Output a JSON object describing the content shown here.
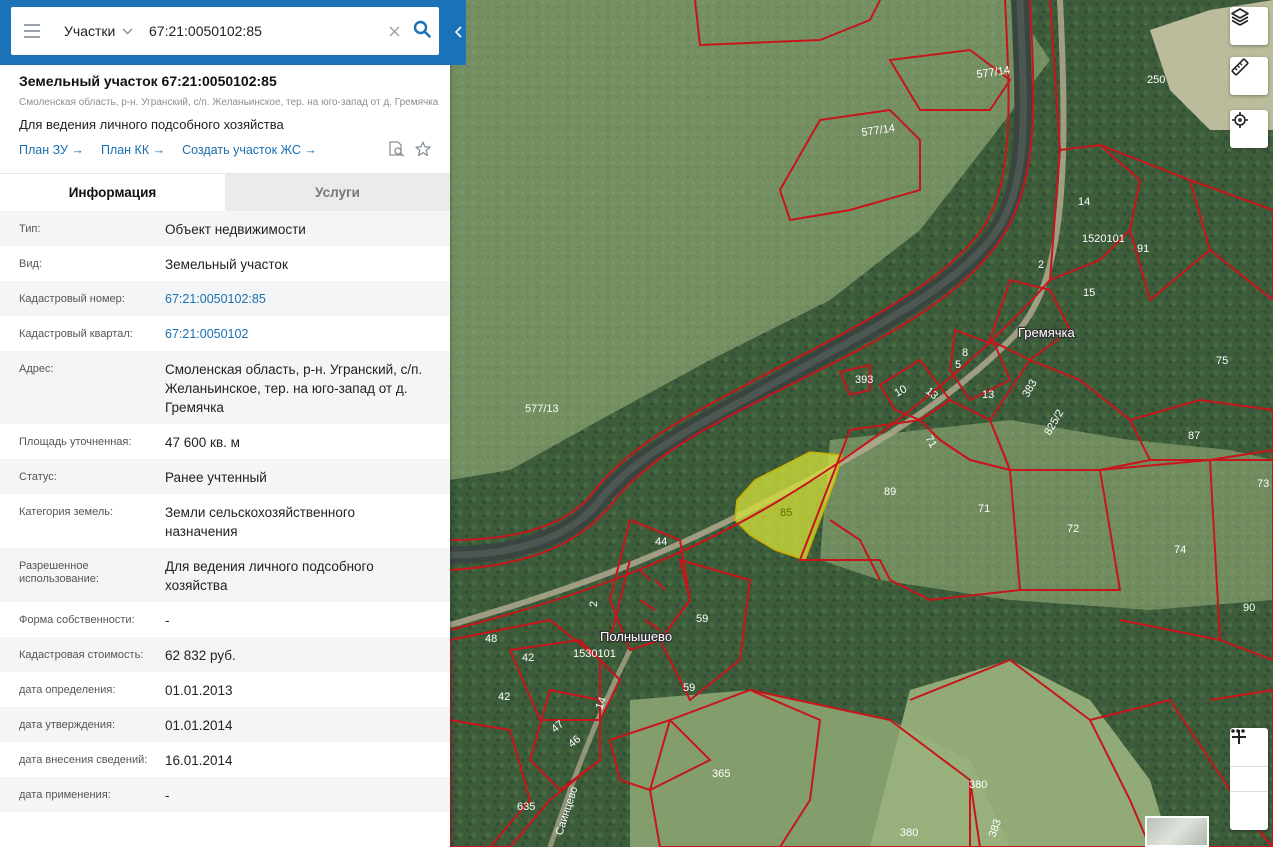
{
  "search": {
    "type_label": "Участки",
    "query": "67:21:0050102:85"
  },
  "object": {
    "title": "Земельный участок 67:21:0050102:85",
    "address_small": "Смоленская область, р-н. Угранский, с/п. Желаньинское, тер. на юго-запад от д. Гремячка",
    "purpose": "Для ведения личного подсобного хозяйства",
    "links": [
      "План ЗУ →",
      "План КК →",
      "Создать участок ЖС →"
    ]
  },
  "tabs": [
    "Информация",
    "Услуги"
  ],
  "info_rows": [
    {
      "label": "Тип:",
      "value": "Объект недвижимости"
    },
    {
      "label": "Вид:",
      "value": "Земельный участок"
    },
    {
      "label": "Кадастровый номер:",
      "value": "67:21:0050102:85",
      "link": true
    },
    {
      "label": "Кадастровый квартал:",
      "value": "67:21:0050102",
      "link": true
    },
    {
      "label": "Адрес:",
      "value": "Смоленская область, р-н. Угранский, с/п. Желаньинское, тер. на юго-запад от д. Гремячка"
    },
    {
      "label": "Площадь уточненная:",
      "value": "47 600 кв. м"
    },
    {
      "label": "Статус:",
      "value": "Ранее учтенный"
    },
    {
      "label": "Категория земель:",
      "value": "Земли сельскохозяйственного назначения"
    },
    {
      "label": "Разрешенное использование:",
      "value": "Для ведения личного подсобного хозяйства"
    },
    {
      "label": "Форма собственности:",
      "value": "-"
    },
    {
      "label": "Кадастровая стоимость:",
      "value": "62 832 руб."
    },
    {
      "label": "дата определения:",
      "value": "01.01.2013"
    },
    {
      "label": "дата утверждения:",
      "value": "01.01.2014"
    },
    {
      "label": "дата внесения сведений:",
      "value": "16.01.2014"
    },
    {
      "label": "дата применения:",
      "value": "-"
    }
  ],
  "map": {
    "places": [
      "Гремячка",
      "Полнышево"
    ],
    "plot_numbers": [
      "577/14",
      "577/14",
      "250",
      "14",
      "1520101",
      "91",
      "2",
      "15",
      "393",
      "8",
      "5",
      "10",
      "13",
      "13",
      "383",
      "75",
      "577/13",
      "71",
      "825/2",
      "87",
      "85",
      "89",
      "71",
      "72",
      "73",
      "44",
      "74",
      "2",
      "59",
      "90",
      "48",
      "42",
      "1530101",
      "42",
      "59",
      "14",
      "47",
      "46",
      "365",
      "380",
      "635",
      "380",
      "383"
    ],
    "road_label": "Саинцево",
    "colors": {
      "parcel_border": "#c8151b",
      "selected_fill": "#d6e23a",
      "forest": "#3f5f3c",
      "field": "#7f9a6a",
      "river": "#3b4540",
      "road": "#b8ae94",
      "accent": "#1a73b8"
    },
    "controls": [
      "layers-icon",
      "ruler-icon",
      "locate-icon",
      "zoom-in-icon",
      "more-icon",
      "zoom-out-icon"
    ]
  }
}
